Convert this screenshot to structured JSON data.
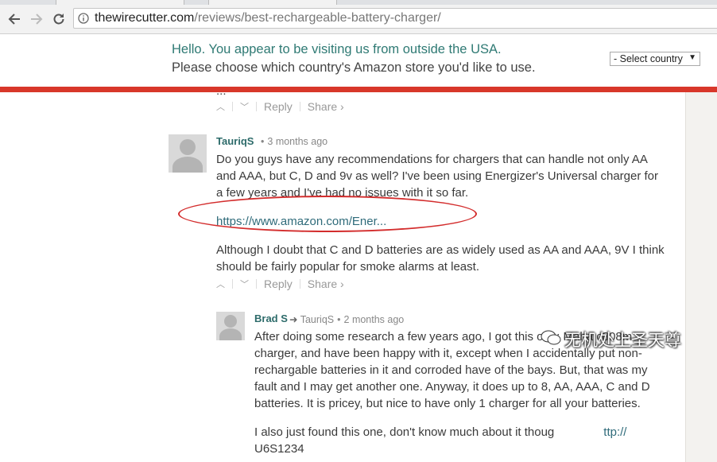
{
  "browser": {
    "url_domain": "thewirecutter.com",
    "url_path": "/reviews/best-rechargeable-battery-charger/"
  },
  "banner": {
    "line1": "Hello. You appear to be visiting us from outside the USA.",
    "line2": "Please choose which country's Amazon store you'd like to use.",
    "select_value": "- Select country",
    "select_arrow": "▼"
  },
  "comments": {
    "actions": {
      "reply": "Reply",
      "share": "Share ›"
    },
    "top_partial": "...",
    "comment1": {
      "author": "TauriqS",
      "time": "3 months ago",
      "p1": "Do you guys have any recommendations for chargers that can handle not only AA and AAA, but C, D and 9v as well? I've been using Energizer's Universal charger for a few years and I've had no issues with it so far.",
      "link": "https://www.amazon.com/Ener...",
      "p2": "Although I doubt that C and D batteries are as widely used as AA and AAA, 9V I think should be fairly popular for smoke alarms at least."
    },
    "reply1": {
      "author": "Brad S",
      "reply_to": "TauriqS",
      "time": "2 months ago",
      "p1": "After doing some research a few years ago, I got this one: Maha c808m charger, and have been happy with it, except when I accidentally put non-rechargable batteries in it and corroded have of the bays. But, that was my fault and I may get another one. Anyway, it does up to 8, AA, AAA, C and D batteries. It is pricey, but nice to have only 1 charger for all your batteries.",
      "p2_start": "I also just found this one, don't know much about it thoug",
      "p2_end": "ttp://",
      "p3": "U6S1234"
    }
  },
  "watermark": {
    "text": "无机处上圣天尊"
  },
  "colors": {
    "accent_red": "#d8372a",
    "teal": "#2f7a74"
  }
}
